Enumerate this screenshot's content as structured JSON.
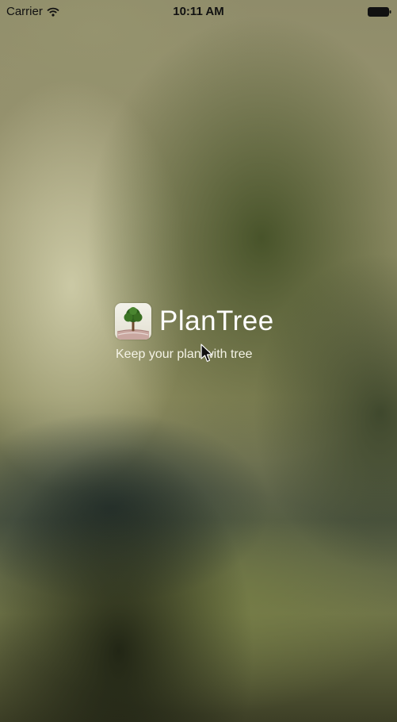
{
  "status_bar": {
    "carrier": "Carrier",
    "time": "10:11 AM",
    "wifi_icon": "wifi-icon",
    "battery_icon": "battery-icon"
  },
  "splash": {
    "app_icon": "tree-app-icon",
    "app_name": "PlanTree",
    "tagline": "Keep your plan with tree"
  },
  "colors": {
    "title_text": "#ffffff",
    "tagline_text": "#f4f3e6",
    "status_text": "#111111"
  }
}
